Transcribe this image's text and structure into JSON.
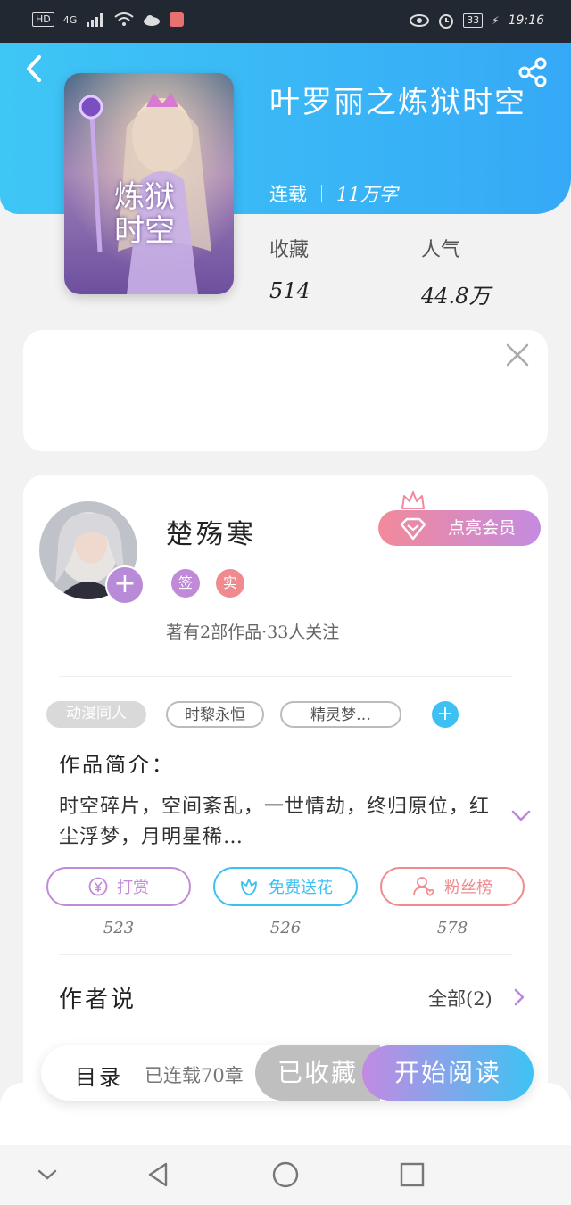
{
  "status_bar": {
    "hd": "HD",
    "network": "4G",
    "battery": "33",
    "time": "19:16"
  },
  "book": {
    "title": "叶罗丽之炼狱时空",
    "status": "连载",
    "word_count": "11万字",
    "favorites_label": "收藏",
    "favorites_value": "514",
    "popularity_label": "人气",
    "popularity_value": "44.8万",
    "cover_title_text": "炼狱时空"
  },
  "author": {
    "name": "楚殇寒",
    "badge_sign": "签",
    "badge_real": "实",
    "info": "著有2部作品·33人关注",
    "vip_button": "点亮会员"
  },
  "tags": [
    "动漫同人",
    "时黎永恒",
    "精灵梦…"
  ],
  "intro": {
    "heading": "作品简介：",
    "text": "时空碎片，空间紊乱，一世情劫，终归原位，红尘浮梦，月明星稀…"
  },
  "actions": [
    {
      "label": "打赏",
      "count": "523",
      "icon": "yen-icon",
      "color": "#c08ad8"
    },
    {
      "label": "免费送花",
      "count": "526",
      "icon": "flower-icon",
      "color": "#3dbff0"
    },
    {
      "label": "粉丝榜",
      "count": "578",
      "icon": "fan-icon",
      "color": "#f08a8e"
    }
  ],
  "author_says": {
    "heading": "作者说",
    "all_link": "全部(2)"
  },
  "bottom_bar": {
    "toc": "目录",
    "chapters": "已连载70章",
    "saved": "已收藏",
    "read": "开始阅读"
  },
  "colors": {
    "header_blue": "#3ec6f5",
    "purple": "#c08ad8",
    "pink": "#f08a8e"
  }
}
